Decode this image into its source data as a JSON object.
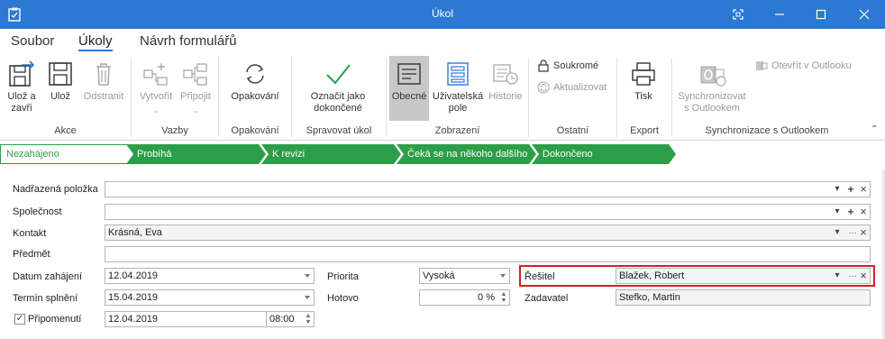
{
  "window": {
    "title": "Úkol"
  },
  "menu": {
    "tabs": [
      "Soubor",
      "Úkoly",
      "Návrh formulářů"
    ],
    "active": "Úkoly"
  },
  "ribbon": {
    "buttons": {
      "save_close": "Ulož a zavři",
      "save": "Ulož",
      "delete": "Odstranit",
      "create": "Vytvořit",
      "attach": "Připojit",
      "repeat": "Opakování",
      "mark_done": "Označit jako dokončené",
      "general": "Obecné",
      "user_fields": "Uživatelská pole",
      "history": "Historie",
      "private": "Soukromé",
      "refresh": "Aktualizovat",
      "print": "Tisk",
      "sync_outlook": "Synchronizovat s Outlookem",
      "open_outlook": "Otevřít v Outlooku"
    },
    "groups": {
      "actions": "Akce",
      "links": "Vazby",
      "repeat": "Opakování",
      "manage": "Spravovat úkol",
      "view": "Zobrazení",
      "other": "Ostatní",
      "export": "Export",
      "sync": "Synchronizace s Outlookem"
    }
  },
  "steps": [
    "Nezahájeno",
    "Probíhá",
    "K revizi",
    "Čeká se na někoho dalšího",
    "Dokončeno"
  ],
  "form": {
    "parent_label": "Nadřazená položka",
    "parent_value": "",
    "company_label": "Společnost",
    "company_value": "",
    "contact_label": "Kontakt",
    "contact_value": "Krásná, Eva",
    "subject_label": "Předmět",
    "subject_value": "",
    "start_label": "Datum zahájení",
    "start_value": "12.04.2019",
    "due_label": "Termín splnění",
    "due_value": "15.04.2019",
    "reminder_label": "Připomenutí",
    "reminder_checked": true,
    "reminder_date": "12.04.2019",
    "reminder_time": "08:00",
    "priority_label": "Priorita",
    "priority_value": "Vysoká",
    "done_label": "Hotovo",
    "done_value": "0 %",
    "assignee_label": "Řešitel",
    "assignee_value": "Blažek, Robert",
    "requester_label": "Zadavatel",
    "requester_value": "Stefko, Martin"
  },
  "icons": {
    "plus": "+",
    "close": "×",
    "ellipsis": "···",
    "check": "✓"
  },
  "colors": {
    "titlebar": "#2b79d3",
    "step_green": "#2c9e48",
    "highlight": "#d21f26"
  }
}
